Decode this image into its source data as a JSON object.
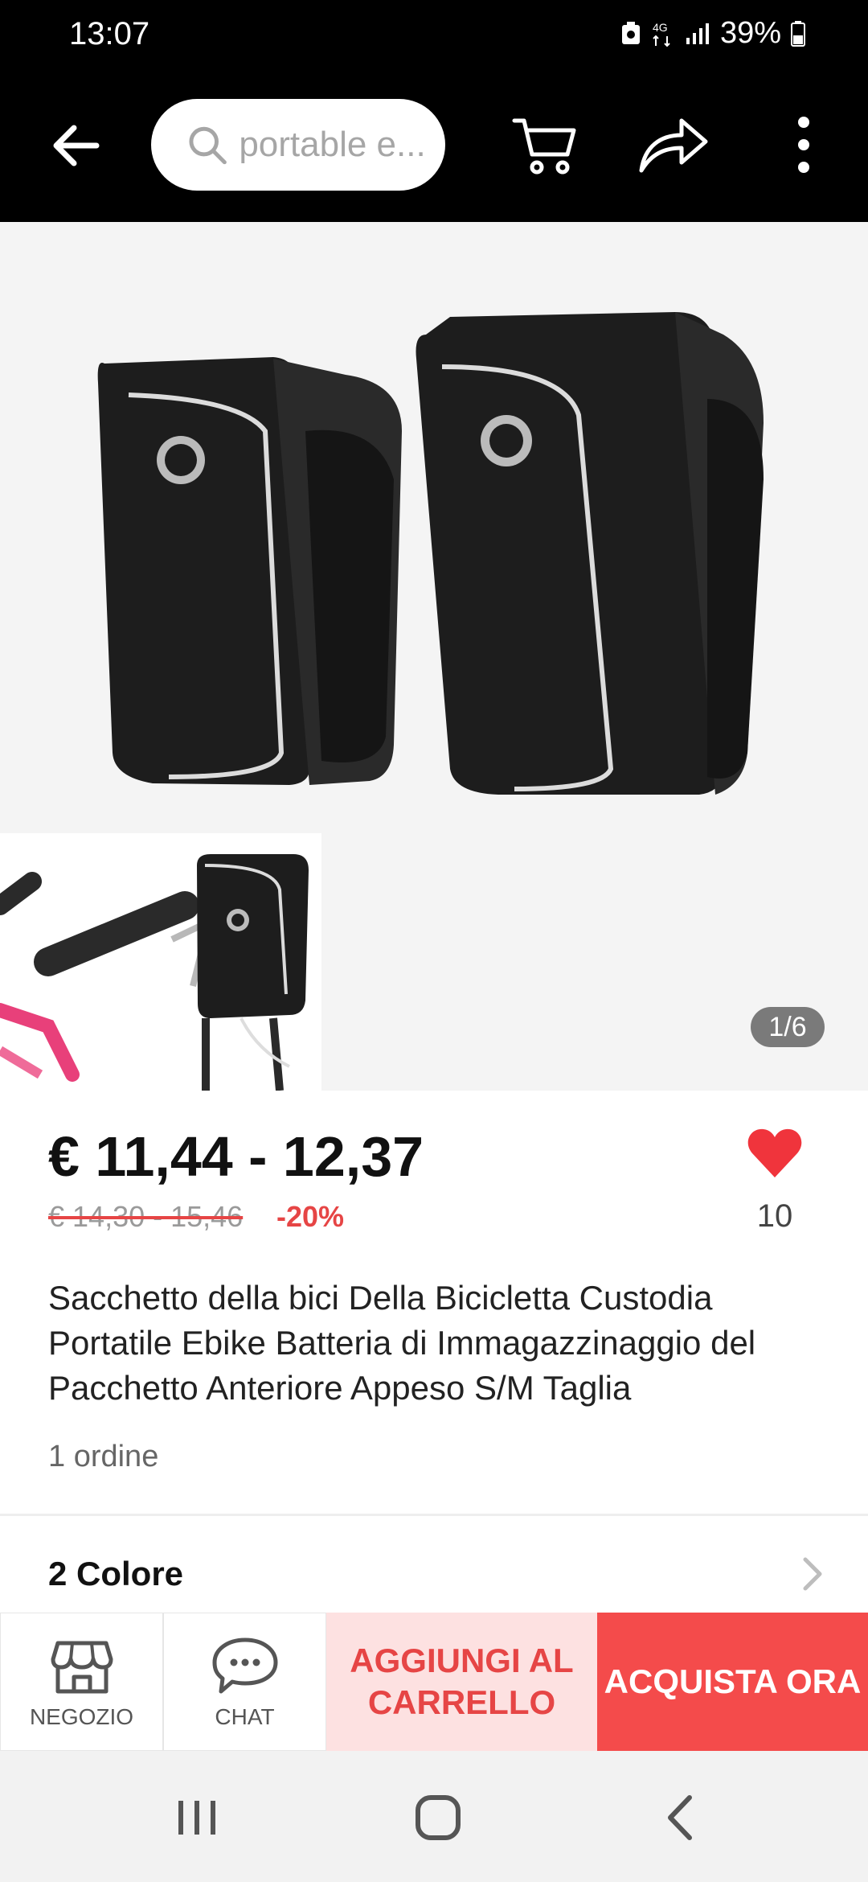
{
  "status_bar": {
    "time": "13:07",
    "battery_percent": "39%",
    "network": "4G",
    "icons": [
      "recycle-icon",
      "network-4g-icon",
      "signal-icon",
      "battery-icon"
    ]
  },
  "top_bar": {
    "search_placeholder": "portable e...",
    "icons": [
      "back-arrow-icon",
      "search-icon",
      "cart-icon",
      "share-icon",
      "more-vertical-icon"
    ]
  },
  "gallery": {
    "counter": "1/6"
  },
  "product": {
    "price": "€ 11,44 - 12,37",
    "original_price": "€ 14,30 - 15,46",
    "discount": "-20%",
    "wishlist_count": "10",
    "title": "Sacchetto della bici Della Bicicletta Custodia Portatile Ebike Batteria di Immagazzinaggio del Pacchetto Anteriore Appeso S/M Taglia",
    "orders": "1 ordine"
  },
  "variants": {
    "label": "2 Colore"
  },
  "bottom_bar": {
    "store_label": "NEGOZIO",
    "chat_label": "CHAT",
    "add_to_cart": "AGGIUNGI AL\nCARRELLO",
    "buy_now": "ACQUISTA ORA"
  },
  "colors": {
    "accent_red": "#f44b4b",
    "soft_red": "#fde1e1",
    "text_red": "#e64545"
  }
}
